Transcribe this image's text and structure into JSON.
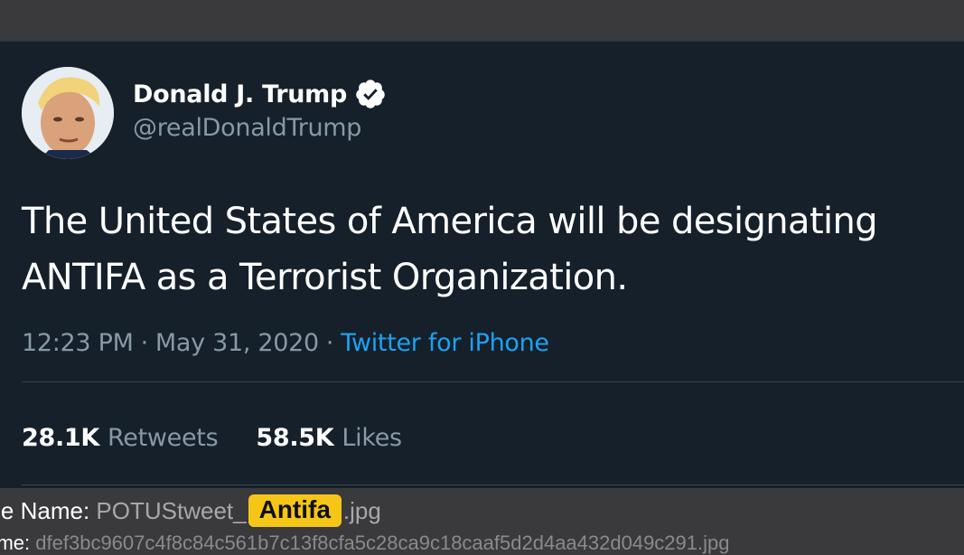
{
  "tweet": {
    "display_name": "Donald J. Trump",
    "handle": "@realDonaldTrump",
    "text": "The United States of America will be designating ANTIFA as a Terrorist Organization.",
    "time": "12:23 PM",
    "date": "May 31, 2020",
    "source": "Twitter for iPhone",
    "retweets_count": "28.1K",
    "retweets_label": "Retweets",
    "likes_count": "58.5K",
    "likes_label": "Likes",
    "verified": true
  },
  "caption": {
    "line1_label": "age Name:",
    "line1_prefix": "POTUStweet_",
    "line1_highlight": "Antifa",
    "line1_suffix": ".jpg",
    "line2_label": "name:",
    "line2_value": "dfef3bc9607c4f8c84c561b7c13f8cfa5c28ca9c18caaf5d2d4aa432d049c291.jpg"
  },
  "colors": {
    "card_bg": "#15202b",
    "accent": "#1da1f2",
    "muted": "#8899a6",
    "highlight": "#f5c518"
  }
}
